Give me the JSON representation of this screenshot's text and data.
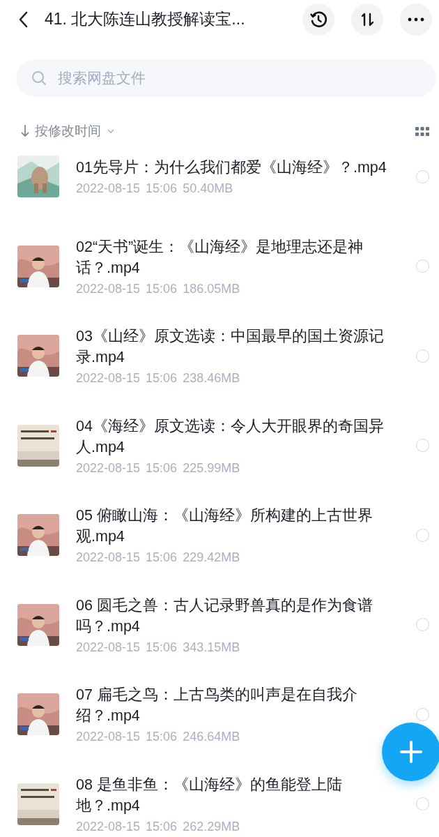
{
  "header": {
    "title": "41. 北大陈连山教授解读宝..."
  },
  "search": {
    "placeholder": "搜索网盘文件"
  },
  "sort": {
    "label": "按修改时间"
  },
  "files": [
    {
      "name": "01先导片：为什么我们都爱《山海经》？.mp4",
      "date": "2022-08-15",
      "time": "15:06",
      "size": "50.40MB",
      "selected": false
    },
    {
      "name": "02“天书”诞生：《山海经》是地理志还是神话？.mp4",
      "date": "2022-08-15",
      "time": "15:06",
      "size": "186.05MB",
      "selected": false
    },
    {
      "name": "03《山经》原文选读：中国最早的国土资源记录.mp4",
      "date": "2022-08-15",
      "time": "15:06",
      "size": "238.46MB",
      "selected": false
    },
    {
      "name": "04《海经》原文选读：令人大开眼界的奇国异人.mp4",
      "date": "2022-08-15",
      "time": "15:06",
      "size": "225.99MB",
      "selected": false
    },
    {
      "name": "05 俯瞰山海：《山海经》所构建的上古世界观.mp4",
      "date": "2022-08-15",
      "time": "15:06",
      "size": "229.42MB",
      "selected": false
    },
    {
      "name": "06 圆毛之兽：古人记录野兽真的是作为食谱吗？.mp4",
      "date": "2022-08-15",
      "time": "15:06",
      "size": "343.15MB",
      "selected": false
    },
    {
      "name": "07 扁毛之鸟：上古鸟类的叫声是在自我介绍？.mp4",
      "date": "2022-08-15",
      "time": "15:06",
      "size": "246.64MB",
      "selected": false
    },
    {
      "name": "08 是鱼非鱼：《山海经》的鱼能登上陆地？.mp4",
      "date": "2022-08-15",
      "time": "15:06",
      "size": "262.29MB",
      "selected": false
    }
  ]
}
